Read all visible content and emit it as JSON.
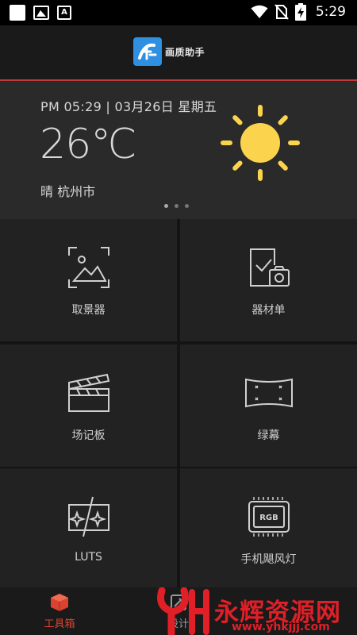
{
  "status_bar": {
    "time": "5:29",
    "icons": [
      "notification-square-icon",
      "image-icon",
      "a-icon",
      "wifi-icon",
      "no-sim-icon",
      "battery-charging-icon"
    ]
  },
  "app": {
    "name": "画质助手",
    "logo_icon": "app-logo-icon",
    "accent": "#c0393b"
  },
  "weather": {
    "date_line": "PM 05:29 | 03月26日 星期五",
    "temperature": "26℃",
    "condition_location": "晴 杭州市",
    "icon": "sun-icon",
    "sun_color": "#fcd34d",
    "pager_count": 3,
    "pager_active": 0
  },
  "tools": [
    {
      "label": "取景器",
      "icon": "viewfinder-icon"
    },
    {
      "label": "器材单",
      "icon": "equipment-list-icon"
    },
    {
      "label": "场记板",
      "icon": "clapperboard-icon"
    },
    {
      "label": "绿幕",
      "icon": "green-screen-icon"
    },
    {
      "label": "LUTS",
      "icon": "luts-icon"
    },
    {
      "label": "手机飓风灯",
      "icon": "rgb-light-icon"
    }
  ],
  "bottom_nav": {
    "items": [
      {
        "label": "工具箱",
        "icon": "toolbox-icon",
        "active": true
      },
      {
        "label": "设计",
        "icon": "design-icon",
        "active": false
      }
    ],
    "active_color": "#d9432f"
  },
  "watermark": {
    "text": "永辉资源网",
    "url": "www.yhkjjj.com",
    "color": "#e01f27"
  }
}
